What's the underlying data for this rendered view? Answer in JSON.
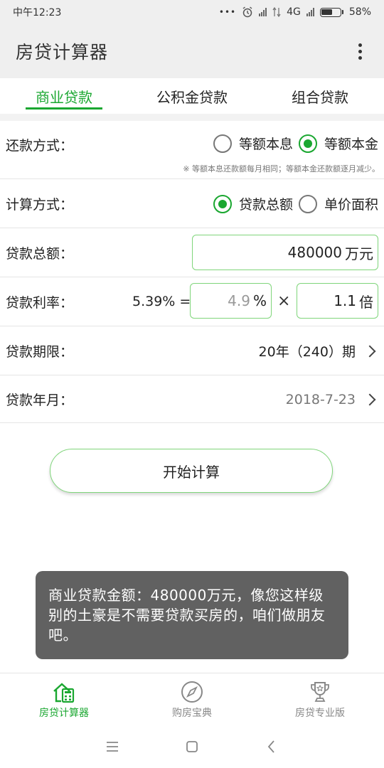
{
  "status_bar": {
    "time": "中午12:23",
    "dots": "•••",
    "network": "4G",
    "battery_percent": "58%",
    "battery_level": 0.58
  },
  "app_bar": {
    "title": "房贷计算器"
  },
  "tabs": [
    {
      "label": "商业贷款",
      "active": true
    },
    {
      "label": "公积金贷款",
      "active": false
    },
    {
      "label": "组合贷款",
      "active": false
    }
  ],
  "repay_method": {
    "label": "还款方式：",
    "options": [
      {
        "label": "等额本息",
        "checked": false
      },
      {
        "label": "等额本金",
        "checked": true
      }
    ],
    "note": "※ 等额本息还款额每月相同；等额本金还款额逐月减少。"
  },
  "calc_method": {
    "label": "计算方式：",
    "options": [
      {
        "label": "贷款总额",
        "checked": true
      },
      {
        "label": "单价面积",
        "checked": false
      }
    ]
  },
  "loan_amount": {
    "label": "贷款总额：",
    "value": "480000",
    "unit": "万元"
  },
  "loan_rate": {
    "label": "贷款利率：",
    "result": "5.39% =",
    "base_placeholder": "4.9",
    "base_unit": "%",
    "times": "×",
    "multiplier": "1.1",
    "multiplier_unit": "倍"
  },
  "loan_term": {
    "label": "贷款期限：",
    "value": "20年（240）期"
  },
  "loan_date": {
    "label": "贷款年月：",
    "value": "2018-7-23"
  },
  "start_button": "开始计算",
  "toast": "商业贷款金额：480000万元，像您这样级别的土豪是不需要贷款买房的，咱们做朋友吧。",
  "bottom_nav": [
    {
      "label": "房贷计算器",
      "icon": "house-calculator-icon",
      "active": true
    },
    {
      "label": "购房宝典",
      "icon": "compass-icon",
      "active": false
    },
    {
      "label": "房贷专业版",
      "icon": "trophy-icon",
      "active": false
    }
  ],
  "colors": {
    "accent": "#1aa730",
    "toast_bg": "#616161"
  }
}
